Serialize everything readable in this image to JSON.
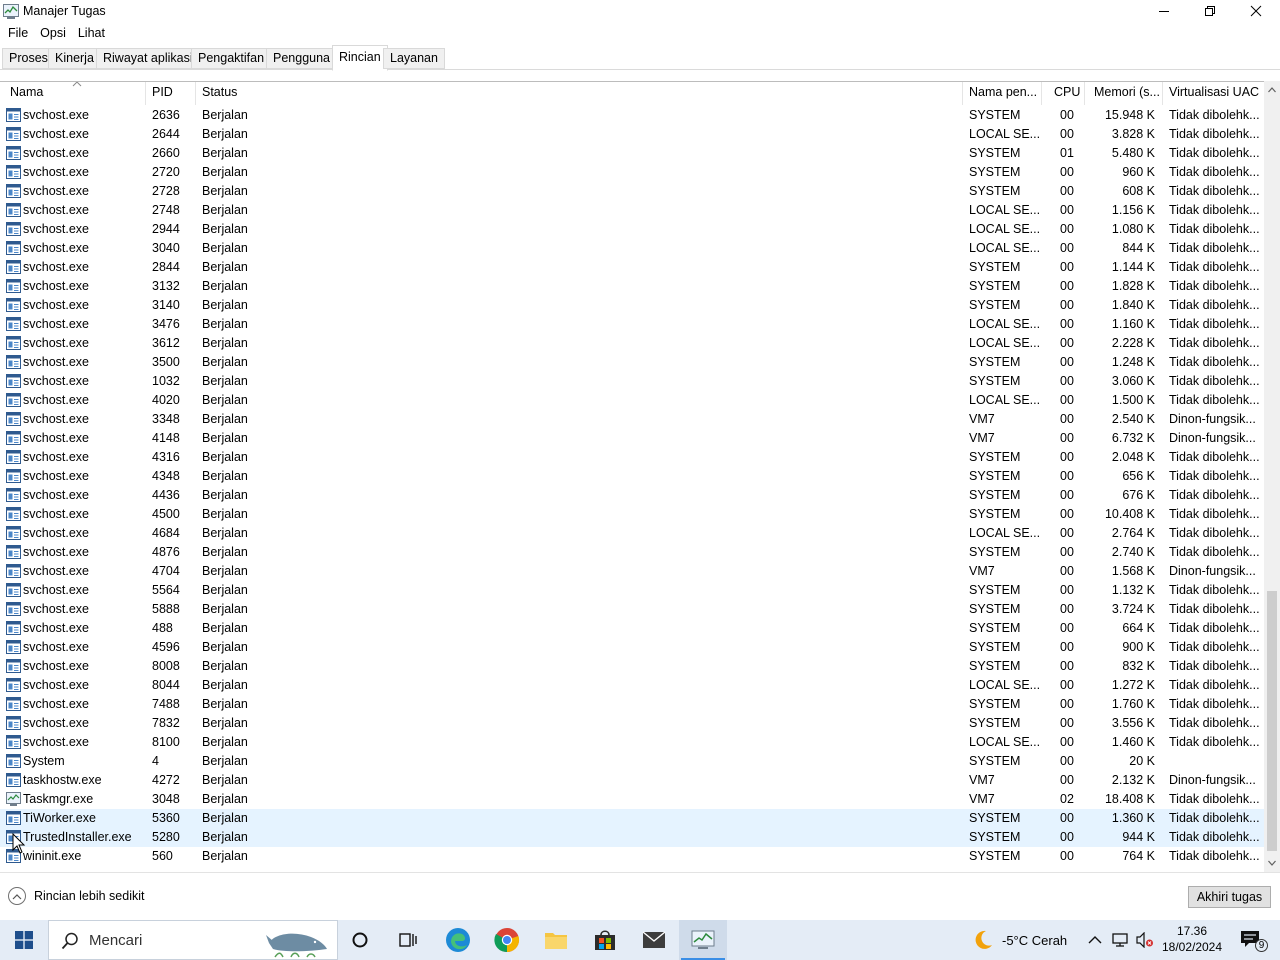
{
  "window": {
    "title": "Manajer Tugas"
  },
  "menu": [
    "File",
    "Opsi",
    "Lihat"
  ],
  "tabs": [
    "Proses",
    "Kinerja",
    "Riwayat aplikasi",
    "Pengaktifan",
    "Pengguna",
    "Rincian",
    "Layanan"
  ],
  "active_tab": "Rincian",
  "columns": [
    "Nama",
    "PID",
    "Status",
    "Nama pen...",
    "CPU",
    "Memori (s...",
    "Virtualisasi UAC"
  ],
  "rows": [
    {
      "name": "svchost.exe",
      "pid": "2636",
      "status": "Berjalan",
      "user": "SYSTEM",
      "cpu": "00",
      "mem": "15.948 K",
      "uac": "Tidak dibolehk..."
    },
    {
      "name": "svchost.exe",
      "pid": "2644",
      "status": "Berjalan",
      "user": "LOCAL SE...",
      "cpu": "00",
      "mem": "3.828 K",
      "uac": "Tidak dibolehk..."
    },
    {
      "name": "svchost.exe",
      "pid": "2660",
      "status": "Berjalan",
      "user": "SYSTEM",
      "cpu": "01",
      "mem": "5.480 K",
      "uac": "Tidak dibolehk..."
    },
    {
      "name": "svchost.exe",
      "pid": "2720",
      "status": "Berjalan",
      "user": "SYSTEM",
      "cpu": "00",
      "mem": "960 K",
      "uac": "Tidak dibolehk..."
    },
    {
      "name": "svchost.exe",
      "pid": "2728",
      "status": "Berjalan",
      "user": "SYSTEM",
      "cpu": "00",
      "mem": "608 K",
      "uac": "Tidak dibolehk..."
    },
    {
      "name": "svchost.exe",
      "pid": "2748",
      "status": "Berjalan",
      "user": "LOCAL SE...",
      "cpu": "00",
      "mem": "1.156 K",
      "uac": "Tidak dibolehk..."
    },
    {
      "name": "svchost.exe",
      "pid": "2944",
      "status": "Berjalan",
      "user": "LOCAL SE...",
      "cpu": "00",
      "mem": "1.080 K",
      "uac": "Tidak dibolehk..."
    },
    {
      "name": "svchost.exe",
      "pid": "3040",
      "status": "Berjalan",
      "user": "LOCAL SE...",
      "cpu": "00",
      "mem": "844 K",
      "uac": "Tidak dibolehk..."
    },
    {
      "name": "svchost.exe",
      "pid": "2844",
      "status": "Berjalan",
      "user": "SYSTEM",
      "cpu": "00",
      "mem": "1.144 K",
      "uac": "Tidak dibolehk..."
    },
    {
      "name": "svchost.exe",
      "pid": "3132",
      "status": "Berjalan",
      "user": "SYSTEM",
      "cpu": "00",
      "mem": "1.828 K",
      "uac": "Tidak dibolehk..."
    },
    {
      "name": "svchost.exe",
      "pid": "3140",
      "status": "Berjalan",
      "user": "SYSTEM",
      "cpu": "00",
      "mem": "1.840 K",
      "uac": "Tidak dibolehk..."
    },
    {
      "name": "svchost.exe",
      "pid": "3476",
      "status": "Berjalan",
      "user": "LOCAL SE...",
      "cpu": "00",
      "mem": "1.160 K",
      "uac": "Tidak dibolehk..."
    },
    {
      "name": "svchost.exe",
      "pid": "3612",
      "status": "Berjalan",
      "user": "LOCAL SE...",
      "cpu": "00",
      "mem": "2.228 K",
      "uac": "Tidak dibolehk..."
    },
    {
      "name": "svchost.exe",
      "pid": "3500",
      "status": "Berjalan",
      "user": "SYSTEM",
      "cpu": "00",
      "mem": "1.248 K",
      "uac": "Tidak dibolehk..."
    },
    {
      "name": "svchost.exe",
      "pid": "1032",
      "status": "Berjalan",
      "user": "SYSTEM",
      "cpu": "00",
      "mem": "3.060 K",
      "uac": "Tidak dibolehk..."
    },
    {
      "name": "svchost.exe",
      "pid": "4020",
      "status": "Berjalan",
      "user": "LOCAL SE...",
      "cpu": "00",
      "mem": "1.500 K",
      "uac": "Tidak dibolehk..."
    },
    {
      "name": "svchost.exe",
      "pid": "3348",
      "status": "Berjalan",
      "user": "VM7",
      "cpu": "00",
      "mem": "2.540 K",
      "uac": "Dinon-fungsik..."
    },
    {
      "name": "svchost.exe",
      "pid": "4148",
      "status": "Berjalan",
      "user": "VM7",
      "cpu": "00",
      "mem": "6.732 K",
      "uac": "Dinon-fungsik..."
    },
    {
      "name": "svchost.exe",
      "pid": "4316",
      "status": "Berjalan",
      "user": "SYSTEM",
      "cpu": "00",
      "mem": "2.048 K",
      "uac": "Tidak dibolehk..."
    },
    {
      "name": "svchost.exe",
      "pid": "4348",
      "status": "Berjalan",
      "user": "SYSTEM",
      "cpu": "00",
      "mem": "656 K",
      "uac": "Tidak dibolehk..."
    },
    {
      "name": "svchost.exe",
      "pid": "4436",
      "status": "Berjalan",
      "user": "SYSTEM",
      "cpu": "00",
      "mem": "676 K",
      "uac": "Tidak dibolehk..."
    },
    {
      "name": "svchost.exe",
      "pid": "4500",
      "status": "Berjalan",
      "user": "SYSTEM",
      "cpu": "00",
      "mem": "10.408 K",
      "uac": "Tidak dibolehk..."
    },
    {
      "name": "svchost.exe",
      "pid": "4684",
      "status": "Berjalan",
      "user": "LOCAL SE...",
      "cpu": "00",
      "mem": "2.764 K",
      "uac": "Tidak dibolehk..."
    },
    {
      "name": "svchost.exe",
      "pid": "4876",
      "status": "Berjalan",
      "user": "SYSTEM",
      "cpu": "00",
      "mem": "2.740 K",
      "uac": "Tidak dibolehk..."
    },
    {
      "name": "svchost.exe",
      "pid": "4704",
      "status": "Berjalan",
      "user": "VM7",
      "cpu": "00",
      "mem": "1.568 K",
      "uac": "Dinon-fungsik..."
    },
    {
      "name": "svchost.exe",
      "pid": "5564",
      "status": "Berjalan",
      "user": "SYSTEM",
      "cpu": "00",
      "mem": "1.132 K",
      "uac": "Tidak dibolehk..."
    },
    {
      "name": "svchost.exe",
      "pid": "5888",
      "status": "Berjalan",
      "user": "SYSTEM",
      "cpu": "00",
      "mem": "3.724 K",
      "uac": "Tidak dibolehk..."
    },
    {
      "name": "svchost.exe",
      "pid": "488",
      "status": "Berjalan",
      "user": "SYSTEM",
      "cpu": "00",
      "mem": "664 K",
      "uac": "Tidak dibolehk..."
    },
    {
      "name": "svchost.exe",
      "pid": "4596",
      "status": "Berjalan",
      "user": "SYSTEM",
      "cpu": "00",
      "mem": "900 K",
      "uac": "Tidak dibolehk..."
    },
    {
      "name": "svchost.exe",
      "pid": "8008",
      "status": "Berjalan",
      "user": "SYSTEM",
      "cpu": "00",
      "mem": "832 K",
      "uac": "Tidak dibolehk..."
    },
    {
      "name": "svchost.exe",
      "pid": "8044",
      "status": "Berjalan",
      "user": "LOCAL SE...",
      "cpu": "00",
      "mem": "1.272 K",
      "uac": "Tidak dibolehk..."
    },
    {
      "name": "svchost.exe",
      "pid": "7488",
      "status": "Berjalan",
      "user": "SYSTEM",
      "cpu": "00",
      "mem": "1.760 K",
      "uac": "Tidak dibolehk..."
    },
    {
      "name": "svchost.exe",
      "pid": "7832",
      "status": "Berjalan",
      "user": "SYSTEM",
      "cpu": "00",
      "mem": "3.556 K",
      "uac": "Tidak dibolehk..."
    },
    {
      "name": "svchost.exe",
      "pid": "8100",
      "status": "Berjalan",
      "user": "LOCAL SE...",
      "cpu": "00",
      "mem": "1.460 K",
      "uac": "Tidak dibolehk..."
    },
    {
      "name": "System",
      "pid": "4",
      "status": "Berjalan",
      "user": "SYSTEM",
      "cpu": "00",
      "mem": "20 K",
      "uac": ""
    },
    {
      "name": "taskhostw.exe",
      "pid": "4272",
      "status": "Berjalan",
      "user": "VM7",
      "cpu": "00",
      "mem": "2.132 K",
      "uac": "Dinon-fungsik..."
    },
    {
      "name": "Taskmgr.exe",
      "pid": "3048",
      "status": "Berjalan",
      "user": "VM7",
      "cpu": "02",
      "mem": "18.408 K",
      "uac": "Tidak dibolehk...",
      "icon": "taskmgr-icon"
    },
    {
      "name": "TiWorker.exe",
      "pid": "5360",
      "status": "Berjalan",
      "user": "SYSTEM",
      "cpu": "00",
      "mem": "1.360 K",
      "uac": "Tidak dibolehk...",
      "selected": true
    },
    {
      "name": "TrustedInstaller.exe",
      "pid": "5280",
      "status": "Berjalan",
      "user": "SYSTEM",
      "cpu": "00",
      "mem": "944 K",
      "uac": "Tidak dibolehk...",
      "selected": true
    },
    {
      "name": "wininit.exe",
      "pid": "560",
      "status": "Berjalan",
      "user": "SYSTEM",
      "cpu": "00",
      "mem": "764 K",
      "uac": "Tidak dibolehk..."
    }
  ],
  "footer": {
    "fewer_details": "Rincian lebih sedikit",
    "end_task": "Akhiri tugas"
  },
  "taskbar": {
    "search_placeholder": "Mencari",
    "weather": "-5°C  Cerah",
    "time": "17.36",
    "date": "18/02/2024",
    "notification_count": "9"
  },
  "colors": {
    "selected_row": "#e5f3ff",
    "taskbar": "#e4ecf6",
    "accent": "#3a8ee6"
  }
}
